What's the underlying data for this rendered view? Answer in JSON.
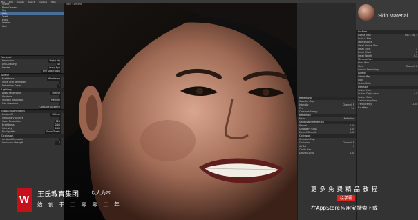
{
  "menubar": {
    "items": [
      "File",
      "Edit",
      "Create",
      "Select",
      "Capture",
      "Help"
    ]
  },
  "outliner": {
    "rows": [
      "Scene",
      "Main Camera",
      "Sky",
      "Skin",
      "Teeth",
      "Eyes",
      "Lashes",
      "Hair"
    ]
  },
  "left_sections": {
    "viewport": {
      "header": "Viewport",
      "rows": [
        {
          "label": "Resolution",
          "value": "High (4K)"
        },
        {
          "label": "Anti-Aliasing",
          "value": "4x"
        },
        {
          "label": "Render",
          "value": "Lamp Eye"
        },
        {
          "label": "",
          "value": "Eye Separation"
        }
      ]
    },
    "scene": {
      "header": "Scene",
      "rows": [
        {
          "label": "Brightness",
          "value": "Wireframe"
        },
        {
          "label": "Show Grid Reflection",
          "value": ""
        },
        {
          "label": "Refraction Scale",
          "value": "1"
        }
      ]
    },
    "lighting": {
      "header": "Lighting",
      "rows": [
        {
          "label": "Local Reflections",
          "value": "Diffuse"
        },
        {
          "label": "Shadows",
          "value": ""
        },
        {
          "label": "Shadow Resolution",
          "value": "Medium"
        },
        {
          "label": "Use Cascades",
          "value": ""
        },
        {
          "label": "",
          "value": "Cascade Distance"
        }
      ]
    },
    "gi": {
      "header": "Global Illumination",
      "rows": [
        {
          "label": "Enable GI",
          "value": "Diffuse"
        },
        {
          "label": "Secondary Bounce",
          "value": ""
        },
        {
          "label": "Voxel Resolution",
          "value": "128"
        },
        {
          "label": "Brightness",
          "value": "0.00"
        },
        {
          "label": "Intensity",
          "value": "0.00"
        },
        {
          "label": "No Vignette",
          "value": "Show Texels"
        }
      ]
    },
    "occlusion": {
      "header": "Occlusion",
      "rows": [
        {
          "label": "Ambient Occlusion",
          "value": ""
        },
        {
          "label": "Occlusion Strength",
          "value": "1.0"
        }
      ]
    }
  },
  "viewport": {
    "title": "Main Camera",
    "status": "Full Screen"
  },
  "material_header": {
    "title": "Skin Material"
  },
  "mid_panel": {
    "sections": [
      {
        "header": "Reflectivity",
        "rows": [
          {
            "label": "Specular Map",
            "value": ""
          },
          {
            "label": "Intensity",
            "value": "Channel: R"
          },
          {
            "label": "Tint",
            "value": "1.0"
          },
          {
            "label": "Conserve Energy",
            "value": ""
          }
        ]
      },
      {
        "header": "Reflection",
        "rows": [
          {
            "label": "Mirror",
            "value": "Reflection"
          }
        ]
      },
      {
        "header": "Secondary Reflection",
        "rows": [
          {
            "label": "Fresnel",
            "value": "0.00"
          },
          {
            "label": "Secondary Gloss",
            "value": "0.00"
          },
          {
            "label": "Fresnel Strength",
            "value": "0.00"
          }
        ]
      },
      {
        "header": "Occlusion",
        "rows": [
          {
            "label": "Occlusion Map",
            "value": ""
          },
          {
            "label": "Occlusion",
            "value": "Channel: R"
          },
          {
            "label": "UV Set",
            "value": "0"
          },
          {
            "label": "Cavity Map",
            "value": ""
          },
          {
            "label": "Diffuse Cavity",
            "value": "1.00"
          }
        ]
      }
    ]
  },
  "right_panel": {
    "sections": [
      {
        "header": "Surface",
        "rows": [
          {
            "label": "Normal Map",
            "value": "Flip X  Flip Y"
          },
          {
            "label": "Scale & Bias",
            "value": ""
          },
          {
            "label": "Object Space",
            "value": ""
          },
          {
            "label": "Detail Normal Map",
            "value": ""
          },
          {
            "label": "Detail Tiling",
            "value": "1"
          },
          {
            "label": "Detail Offset",
            "value": "0"
          },
          {
            "label": "Detail Weight",
            "value": "0.3"
          }
        ]
      },
      {
        "header": "Microsurface",
        "rows": [
          {
            "label": "Gloss Map",
            "value": ""
          },
          {
            "label": "Gloss",
            "value": "Channel: A"
          },
          {
            "label": "Horizon Smoothing",
            "value": ""
          }
        ]
      },
      {
        "header": "Albedo",
        "rows": [
          {
            "label": "Albedo Map",
            "value": ""
          },
          {
            "label": "Color",
            "value": ""
          },
          {
            "label": "Vertex Color",
            "value": ""
          }
        ]
      },
      {
        "header": "Diffusion",
        "rows": [
          {
            "label": "Scatter Map",
            "value": ""
          },
          {
            "label": "Scatter Depth (mm)",
            "value": "4.0"
          },
          {
            "label": "Scatter Color",
            "value": ""
          },
          {
            "label": "Translucency Map",
            "value": ""
          },
          {
            "label": "Translucency",
            "value": "1.00"
          },
          {
            "label": "Fuzz Map",
            "value": ""
          }
        ]
      }
    ]
  },
  "branding": {
    "company": "王氏教育集团",
    "slogan": "以人为本",
    "founded": "始 创 于 二 零 零 二 年"
  },
  "promo": {
    "line1": "更多免费精品教程",
    "badge": "绘学霸",
    "line2_prefix": "在AppStore",
    "line2_highlight": "应用宝",
    "line2_suffix": "搜索下载"
  },
  "colors": {
    "brand_red": "#c1121b",
    "accent_blue": "#4f6e96",
    "panel": "#333333"
  }
}
